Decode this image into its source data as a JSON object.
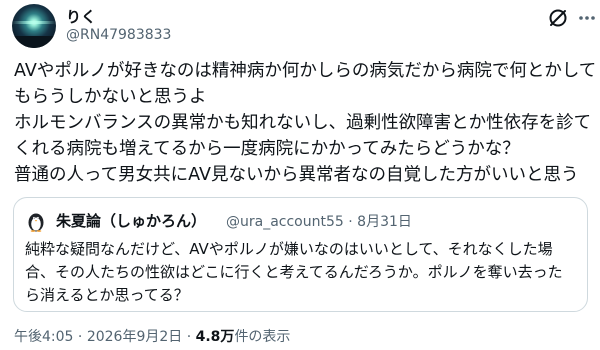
{
  "author": {
    "display_name": "りく",
    "handle": "@RN47983833",
    "avatar": "night-sky-glow-avatar"
  },
  "header_icons": [
    "grok-icon",
    "more-icon"
  ],
  "tweet": {
    "lines": [
      "AVやポルノが好きなのは精神病か何かしらの病気だから病院で何とかして",
      "もらうしかないと思うよ",
      "ホルモンバランスの異常かも知れないし、過剰性欲障害とか性依存を診て",
      "くれる病院も増えてるから一度病院にかかってみたらどうかな？",
      "普通の人って男女共にAV見ないから異常者なの自覚した方がいいと思う"
    ]
  },
  "quote": {
    "display_name": "朱夏論（しゅかろん）",
    "handle": "@ura_account55",
    "separator": "·",
    "date": "8月31日",
    "avatar": "penguin-avatar",
    "lines": [
      "純粋な疑問なんだけど、AVやポルノが嫌いなのはいいとして、それなくした場",
      "合、その人たちの性欲はどこに行くと考えてるんだろうか。ポルノを奪い去った",
      "ら消えるとか思ってる？"
    ]
  },
  "footer": {
    "time": "午後4:05",
    "separator": "·",
    "date": "2026年9月2日",
    "views_count": "4.8万",
    "views_label": "件の表示"
  }
}
